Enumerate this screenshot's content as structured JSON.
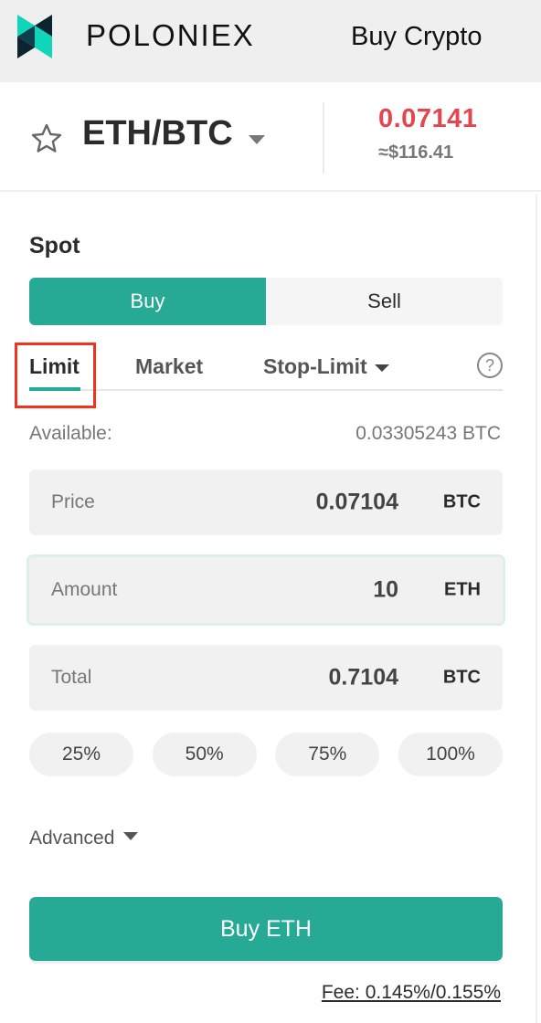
{
  "header": {
    "brand": "POLONIEX",
    "logo_icon": "poloniex-logo-icon",
    "buy_crypto_label": "Buy Crypto"
  },
  "pair": {
    "favorite_icon": "star-outline-icon",
    "name": "ETH/BTC",
    "dropdown_icon": "caret-down-icon",
    "last_price": "0.07141",
    "usd_price": "≈$116.41",
    "last_price_color": "#e4454f"
  },
  "panel": {
    "title": "Spot",
    "side_toggle": {
      "buy_label": "Buy",
      "sell_label": "Sell",
      "selected": "Buy"
    },
    "order_tabs": [
      {
        "label": "Limit",
        "active": true
      },
      {
        "label": "Market",
        "active": false
      },
      {
        "label": "Stop-Limit",
        "active": false,
        "has_dropdown": true
      }
    ],
    "help_icon": "?",
    "available": {
      "label": "Available:",
      "value": "0.03305243 BTC"
    },
    "fields": {
      "price": {
        "label": "Price",
        "value": "0.07104",
        "unit": "BTC"
      },
      "amount": {
        "label": "Amount",
        "value": "10",
        "unit": "ETH",
        "focused": true
      },
      "total": {
        "label": "Total",
        "value": "0.7104",
        "unit": "BTC"
      }
    },
    "percent_buttons": [
      "25%",
      "50%",
      "75%",
      "100%"
    ],
    "advanced_label": "Advanced",
    "submit_label": "Buy ETH",
    "fee_label": "Fee: 0.145%/0.155%"
  },
  "colors": {
    "accent": "#26a995",
    "sell_price": "#e4454f",
    "highlight_box": "#f0331c",
    "header_bg": "#efefef"
  }
}
